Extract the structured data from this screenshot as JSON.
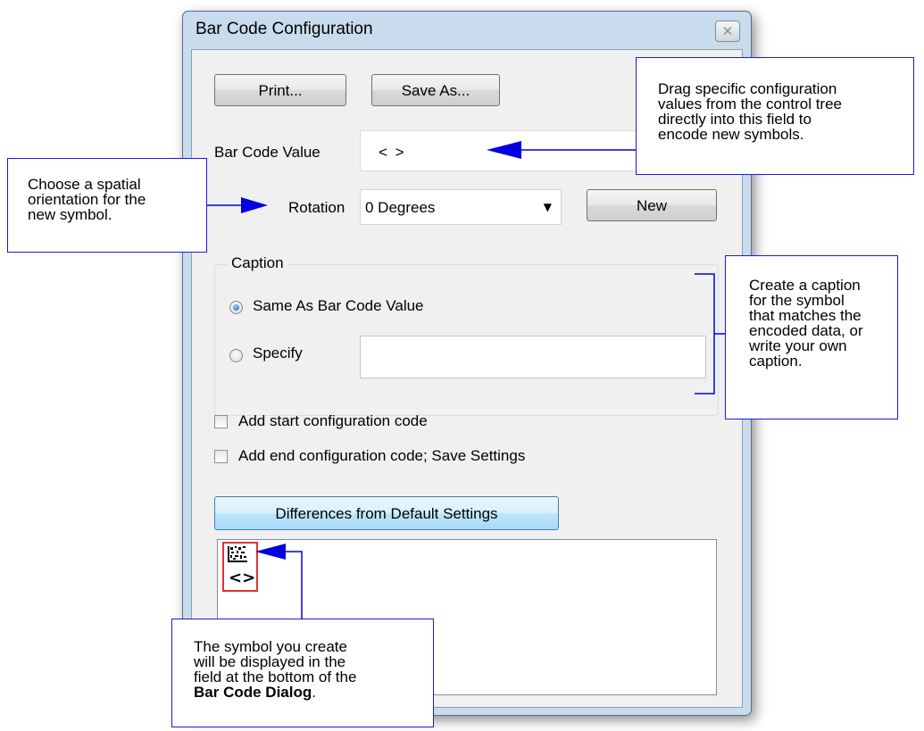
{
  "dialog": {
    "title": "Bar Code Configuration",
    "close_icon": "close-icon",
    "print_label": "Print...",
    "save_as_label": "Save As...",
    "bar_code_value_label": "Bar Code Value",
    "bar_code_value": "<   >",
    "rotation_label": "Rotation",
    "rotation_value": "0 Degrees",
    "new_label": "New",
    "caption": {
      "title": "Caption",
      "same_label": "Same As Bar Code Value",
      "specify_label": "Specify",
      "specify_value": "",
      "selected": "same"
    },
    "add_start_label": "Add start configuration code",
    "add_end_label": "Add end configuration code; Save Settings",
    "differences_label": "Differences from Default Settings",
    "preview_symbol_text": "<>"
  },
  "callouts": {
    "bar_code_value": {
      "lines": [
        "Drag specific configuration",
        "values from the control tree",
        "directly into this field to",
        "encode new symbols."
      ]
    },
    "rotation": {
      "lines": [
        "Choose a spatial",
        "orientation for the",
        "new symbol."
      ]
    },
    "caption": {
      "lines": [
        "Create a caption",
        "for the symbol",
        "that matches the",
        "encoded data, or",
        "write your own",
        "caption."
      ]
    },
    "symbol": {
      "lines": [
        "The symbol you create",
        "will be displayed in the",
        "field at the bottom of the"
      ],
      "bold": "Bar Code Dialog",
      "tail": "."
    }
  },
  "colors": {
    "callout_border": "#1a1adb",
    "arrow": "#0000e0",
    "symbol_border": "#e23131"
  }
}
